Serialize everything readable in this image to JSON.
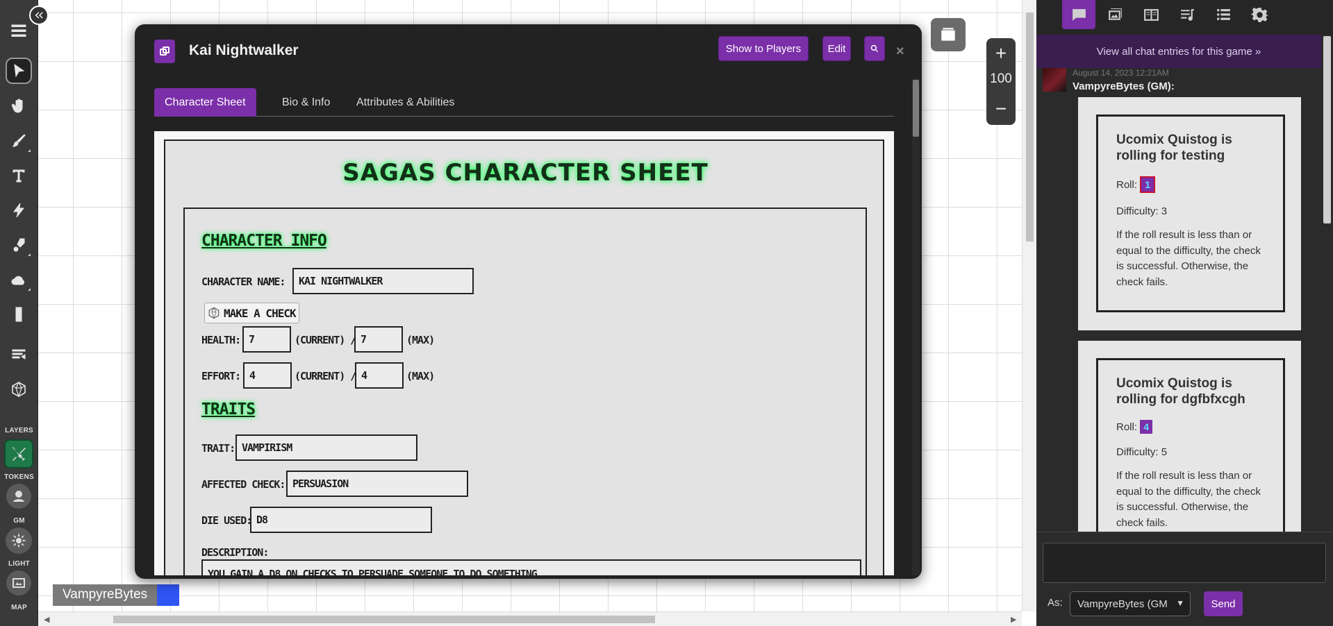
{
  "map": {
    "zoom_value": "100",
    "zoom_in": "+",
    "zoom_out": "−",
    "player_name": "VampyreBytes",
    "player_color": "#2f55f3"
  },
  "toolbar": {
    "layers_label": "LAYERS",
    "tokens_label": "TOKENS",
    "gm_label": "GM",
    "light_label": "LIGHT",
    "map_label": "MAP",
    "icons": [
      "menu-icon",
      "select-icon",
      "pan-icon",
      "draw-icon",
      "text-icon",
      "fx-icon",
      "paint-icon",
      "weather-icon",
      "ruler-icon",
      "turn-order-icon",
      "dice-icon"
    ]
  },
  "dialog": {
    "title": "Kai Nightwalker",
    "show_to_players": "Show to Players",
    "edit": "Edit",
    "close": "×",
    "tabs": [
      "Character Sheet",
      "Bio & Info",
      "Attributes & Abilities"
    ],
    "active_tab": "Character Sheet"
  },
  "sheet": {
    "title": "Sagas Character Sheet",
    "info_heading": "Character Info",
    "name_label": "Character Name:",
    "name_value": "Kai Nightwalker",
    "check_button": "Make a Check",
    "health_label": "Health:",
    "health_current": "7",
    "health_max": "7",
    "current_label": "(Current) /",
    "max_label": "(Max)",
    "effort_label": "Effort:",
    "effort_current": "4",
    "effort_max": "4",
    "traits_heading": "Traits",
    "trait_label": "Trait:",
    "trait_value": "Vampirism",
    "affected_label": "Affected Check:",
    "affected_value": "Persuasion",
    "die_label": "Die Used:",
    "die_value": "D8",
    "desc_label": "Description:",
    "desc_value": "You gain a D8 on checks to persuade someone to do something"
  },
  "chat": {
    "tabs": [
      "chat-icon",
      "art-icon",
      "journal-icon",
      "jukebox-icon",
      "collections-icon",
      "settings-icon"
    ],
    "view_all": "View all chat entries for this game »",
    "timestamp": "August 14, 2023 12:21AM",
    "speaker": "VampyreBytes (GM):",
    "rolls": [
      {
        "title": "Ucomix Quistog is rolling for testing",
        "roll_label": "Roll:",
        "roll_value": "1",
        "difficulty": "Difficulty: 3",
        "desc": "If the roll result is less than or equal to the difficulty, the check is successful. Otherwise, the check fails."
      },
      {
        "title": "Ucomix Quistog is rolling for dgfbfxcgh",
        "roll_label": "Roll:",
        "roll_value": "4",
        "difficulty": "Difficulty: 5",
        "desc": "If the roll result is less than or equal to the difficulty, the check is successful. Otherwise, the check fails."
      }
    ],
    "as_label": "As:",
    "as_value": "VampyreBytes (GM",
    "send": "Send"
  }
}
